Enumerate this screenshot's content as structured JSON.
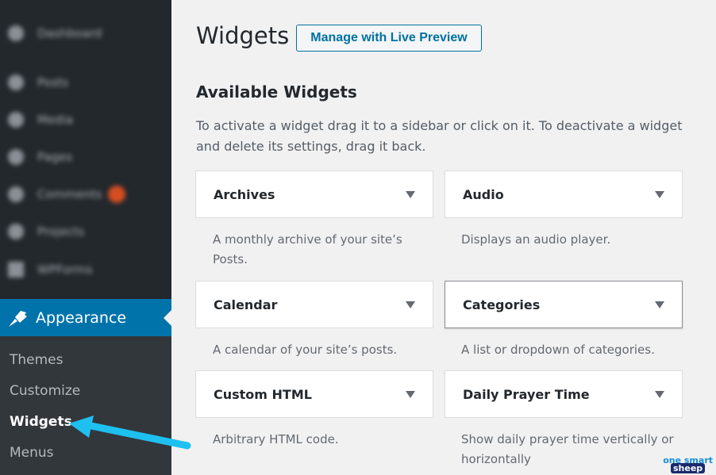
{
  "sidebar": {
    "blurred_items": [
      {
        "label": "Dashboard",
        "icon": "dashboard-icon"
      },
      {
        "label": "Posts",
        "icon": "pin-icon"
      },
      {
        "label": "Media",
        "icon": "media-icon"
      },
      {
        "label": "Pages",
        "icon": "pages-icon"
      },
      {
        "label": "Comments",
        "icon": "comments-icon",
        "badge": true
      },
      {
        "label": "Projects",
        "icon": "pin-icon"
      },
      {
        "label": "WPForms",
        "icon": "forms-icon"
      }
    ],
    "active": {
      "label": "Appearance",
      "icon": "paintbrush-icon"
    },
    "submenu": [
      {
        "label": "Themes",
        "current": false
      },
      {
        "label": "Customize",
        "current": false
      },
      {
        "label": "Widgets",
        "current": true
      },
      {
        "label": "Menus",
        "current": false
      }
    ]
  },
  "header": {
    "title": "Widgets",
    "live_preview_label": "Manage with Live Preview"
  },
  "available": {
    "title": "Available Widgets",
    "description": "To activate a widget drag it to a sidebar or click on it. To deactivate a widget and delete its settings, drag it back.",
    "widgets": [
      {
        "title": "Archives",
        "description": "A monthly archive of your site’s Posts."
      },
      {
        "title": "Audio",
        "description": "Displays an audio player."
      },
      {
        "title": "Calendar",
        "description": "A calendar of your site’s posts."
      },
      {
        "title": "Categories",
        "description": "A list or dropdown of categories."
      },
      {
        "title": "Custom HTML",
        "description": "Arbitrary HTML code."
      },
      {
        "title": "Daily Prayer Time",
        "description": "Show daily prayer time vertically or horizontally"
      }
    ]
  },
  "watermark": {
    "line1": "one smart",
    "line2": "sheep"
  },
  "colors": {
    "sidebar_bg": "#23282d",
    "submenu_bg": "#32373c",
    "accent": "#0073aa",
    "arrow": "#1ec0f0",
    "badge": "#d54e21"
  }
}
